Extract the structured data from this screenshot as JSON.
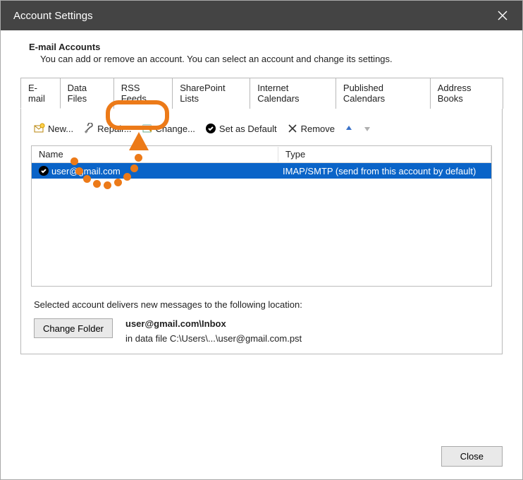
{
  "window": {
    "title": "Account Settings"
  },
  "header": {
    "title": "E-mail Accounts",
    "subtitle": "You can add or remove an account. You can select an account and change its settings."
  },
  "tabs": [
    {
      "label": "E-mail",
      "active": true
    },
    {
      "label": "Data Files"
    },
    {
      "label": "RSS Feeds"
    },
    {
      "label": "SharePoint Lists"
    },
    {
      "label": "Internet Calendars"
    },
    {
      "label": "Published Calendars"
    },
    {
      "label": "Address Books"
    }
  ],
  "toolbar": {
    "new_label": "New...",
    "repair_label": "Repair...",
    "change_label": "Change...",
    "default_label": "Set as Default",
    "remove_label": "Remove"
  },
  "table": {
    "headers": {
      "name": "Name",
      "type": "Type"
    },
    "rows": [
      {
        "name": "user@gmail.com",
        "type": "IMAP/SMTP (send from this account by default)",
        "default": true,
        "selected": true
      }
    ]
  },
  "delivery": {
    "intro": "Selected account delivers new messages to the following location:",
    "change_folder_label": "Change Folder",
    "location_bold": "user@gmail.com\\Inbox",
    "location_path": "in data file C:\\Users\\...\\user@gmail.com.pst"
  },
  "footer": {
    "close_label": "Close"
  },
  "colors": {
    "accent": "#ec7a18",
    "selection": "#0a64c8"
  }
}
